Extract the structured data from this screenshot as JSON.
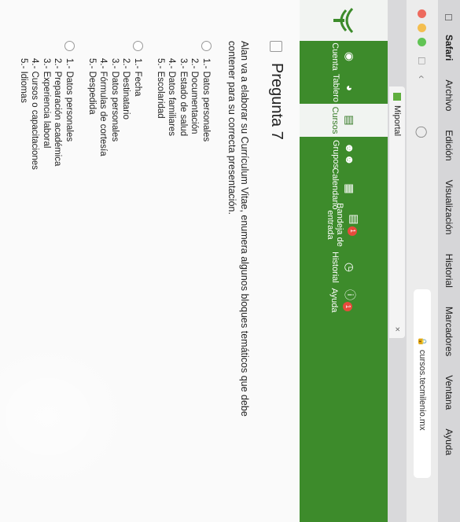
{
  "menubar": {
    "app_name": "Safari",
    "items": [
      "Archivo",
      "Edición",
      "Visualización",
      "Historial",
      "Marcadores",
      "Ventana",
      "Ayuda"
    ]
  },
  "browser": {
    "url": "cursos.tecmilenio.mx",
    "tab_title": "Miportal"
  },
  "sidebar": {
    "items": [
      {
        "label": "Cuenta",
        "icon": "user-icon"
      },
      {
        "label": "Tablero",
        "icon": "dashboard-icon"
      },
      {
        "label": "Cursos",
        "icon": "book-icon",
        "active": true
      },
      {
        "label": "Grupos",
        "icon": "groups-icon"
      },
      {
        "label": "Calendario",
        "icon": "calendar-icon"
      },
      {
        "label": "Bandeja de entrada",
        "icon": "inbox-icon",
        "badge": "1"
      },
      {
        "label": "Historial",
        "icon": "clock-icon"
      },
      {
        "label": "Ayuda",
        "icon": "help-icon",
        "badge": "1"
      }
    ]
  },
  "question": {
    "title": "Pregunta 7",
    "prompt": "Alan va a elaborar su Currículum Vitae, enumera algunos bloques temáticos que debe contener para su correcta presentación.",
    "options": [
      [
        "1.- Datos personales",
        "2.- Documentación",
        "3.- Estado de salud",
        "4.- Datos familiares",
        "5.- Escolaridad"
      ],
      [
        "1.- Fecha",
        "2.- Destinatario",
        "3.- Datos personales",
        "4.- Fórmulas de cortesía",
        "5.- Despedida"
      ],
      [
        "1.- Datos personales",
        "2.- Preparación académica",
        "3.- Experiencia laboral",
        "4.- Cursos o capacitaciones",
        "5.- Idiomas"
      ]
    ]
  },
  "colors": {
    "sidebar_green": "#3d8b2b",
    "badge_red": "#e84b3c"
  }
}
